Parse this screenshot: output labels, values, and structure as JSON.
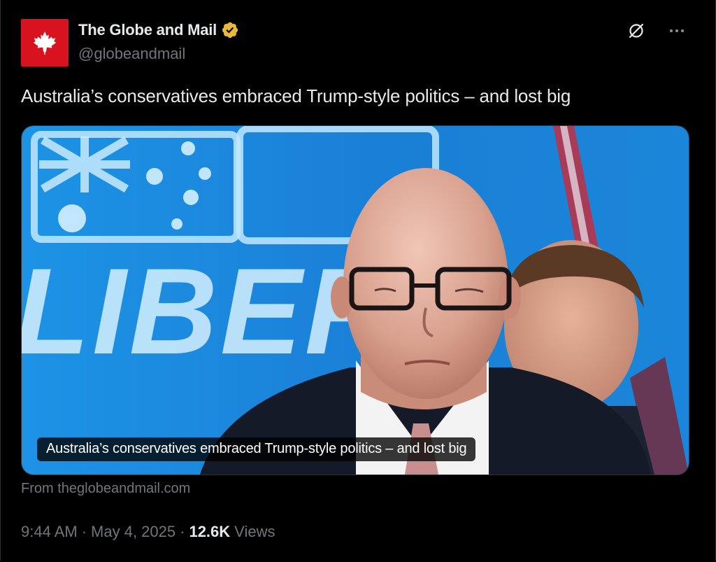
{
  "author": {
    "display_name": "The Globe and Mail",
    "handle": "@globeandmail",
    "verified_badge": "gold-verified-icon",
    "avatar_icon": "maple-leaf-icon",
    "avatar_color": "#d8121f"
  },
  "top_actions": {
    "grok_icon": "grok-icon",
    "more_icon": "more-horizontal-icon"
  },
  "tweet": {
    "text": "Australia’s conservatives embraced Trump-style politics – and lost big"
  },
  "card": {
    "caption": "Australia’s conservatives embraced Trump-style politics – and lost big",
    "backdrop_banner": "LIBERA",
    "source": "From theglobeandmail.com"
  },
  "meta": {
    "time": "9:44 AM",
    "separator": "·",
    "date": "May 4, 2025",
    "views_count": "12.6K",
    "views_label": "Views"
  },
  "colors": {
    "background": "#000000",
    "text_primary": "#e7e9ea",
    "text_secondary": "#71767b",
    "border": "#2f3336",
    "verified_gold": "#e8b83a",
    "photo_blue": "#1b8fe0"
  }
}
